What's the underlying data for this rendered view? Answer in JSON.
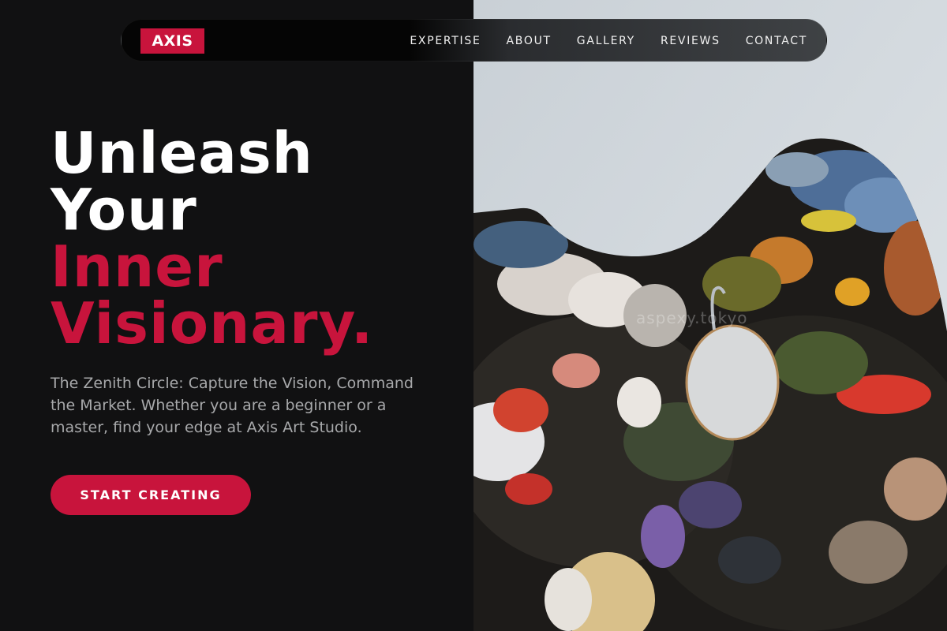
{
  "brand": {
    "logo_text": "AXIS",
    "accent_color": "#c8143c"
  },
  "nav": {
    "links": [
      {
        "label": "EXPERTISE"
      },
      {
        "label": "ABOUT"
      },
      {
        "label": "GALLERY"
      },
      {
        "label": "REVIEWS"
      },
      {
        "label": "CONTACT"
      }
    ]
  },
  "hero": {
    "title_line1": "Unleash",
    "title_line2": "Your",
    "title_line3": "Inner",
    "title_line4": "Visionary.",
    "subtitle": "The Zenith Circle: Capture the Vision, Command the Market. Whether you are a beginner or a master, find your edge at Axis Art Studio.",
    "cta_label": "START CREATING"
  },
  "image": {
    "subject": "paint palette with oil paint",
    "watermark_text": "aspexy.tokyo"
  },
  "colors": {
    "background": "#111112",
    "text_muted": "#a8a9ab",
    "white": "#ffffff"
  }
}
